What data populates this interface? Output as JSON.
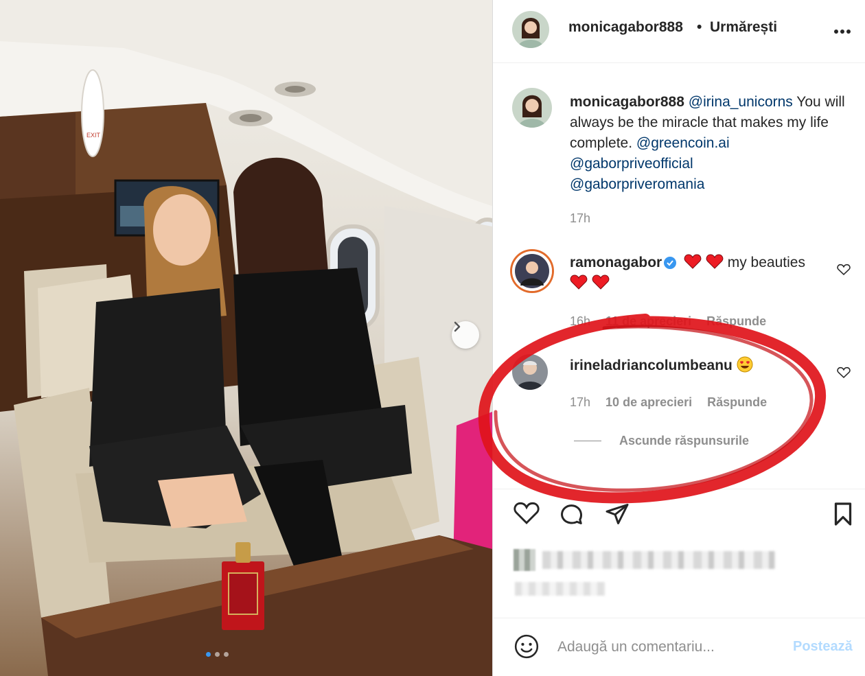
{
  "post": {
    "author": "monicagabor888",
    "separator": "•",
    "follow_status": "Urmărești",
    "more_icon": "more-dots-icon"
  },
  "photo": {
    "exit_sign": "EXIT",
    "carousel": {
      "current": 1,
      "total": 3
    }
  },
  "caption": {
    "author": "monicagabor888",
    "mention_1": "@irina_unicorns",
    "text_1": " You will always be the miracle that makes my life complete. ",
    "mention_2": "@greencoin.ai",
    "mention_3": "@gaborpriveofficial",
    "mention_4": "@gaborpriveromania",
    "time": "17h"
  },
  "comments": [
    {
      "author": "ramonagabor",
      "verified": true,
      "text_before": " my beauties",
      "time": "16h",
      "likes": "11 de aprecieri",
      "reply": "Răspunde"
    },
    {
      "author": "irineladriancolumbeanu",
      "verified": false,
      "time": "17h",
      "likes": "10 de aprecieri",
      "reply": "Răspunde"
    }
  ],
  "hide_replies": "Ascunde răspunsurile",
  "add_comment": {
    "placeholder": "Adaugă un comentariu...",
    "post_label": "Postează"
  },
  "colors": {
    "mention": "#00376b",
    "muted": "#8e8e8e",
    "post_disabled": "#b3dbff",
    "annotation": "#e0141a",
    "heart": "#ed1c24"
  }
}
